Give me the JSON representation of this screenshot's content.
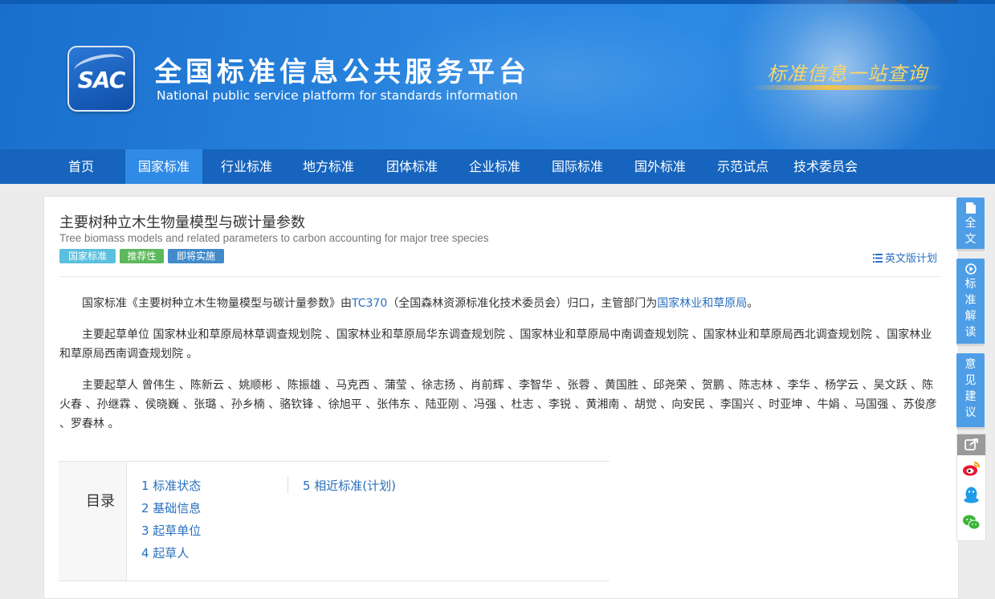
{
  "header": {
    "logo_text": "SAC",
    "title": "全国标准信息公共服务平台",
    "subtitle": "National public service platform  for standards information",
    "slogan": "标准信息一站查询"
  },
  "nav": {
    "items": [
      {
        "label": "首页",
        "active": false
      },
      {
        "label": "国家标准",
        "active": true
      },
      {
        "label": "行业标准",
        "active": false
      },
      {
        "label": "地方标准",
        "active": false
      },
      {
        "label": "团体标准",
        "active": false
      },
      {
        "label": "企业标准",
        "active": false
      },
      {
        "label": "国际标准",
        "active": false
      },
      {
        "label": "国外标准",
        "active": false
      },
      {
        "label": "示范试点",
        "active": false
      },
      {
        "label": "技术委员会",
        "active": false
      }
    ]
  },
  "standard": {
    "title": "主要树种立木生物量模型与碳计量参数",
    "title_en": "Tree biomass models and related parameters to carbon accounting for major tree species",
    "badges": [
      {
        "label": "国家标准",
        "color": "#5bc0de"
      },
      {
        "label": "推荐性",
        "color": "#5cb85c"
      },
      {
        "label": "即将实施",
        "color": "#428bca"
      }
    ],
    "english_plan_label": "英文版计划",
    "intro": {
      "prefix": "国家标准《主要树种立木生物量模型与碳计量参数》由",
      "tc_link": "TC370",
      "middle": "（全国森林资源标准化技术委员会）归口，主管部门为",
      "dept_link": "国家林业和草原局",
      "suffix": "。"
    },
    "drafting_units": "主要起草单位 国家林业和草原局林草调查规划院 、国家林业和草原局华东调查规划院 、国家林业和草原局中南调查规划院 、国家林业和草原局西北调查规划院 、国家林业和草原局西南调查规划院 。",
    "drafters": "主要起草人 曾伟生 、陈新云 、姚顺彬 、陈振雄 、马克西 、蒲莹 、徐志扬 、肖前辉 、李智华 、张蓉 、黄国胜 、邱尧荣 、贺鹏 、陈志林 、李华 、杨学云 、吴文跃 、陈火春 、孙继霖 、侯晓巍 、张璐 、孙乡楠 、骆钦锋 、徐旭平 、张伟东 、陆亚刚 、冯强 、杜志 、李锐 、黄湘南 、胡觉 、向安民 、李国兴 、时亚坤 、牛娟 、马国强 、苏俊彦 、罗春林 。"
  },
  "toc": {
    "label": "目录",
    "items": [
      "1  标准状态",
      "2  基础信息",
      "3  起草单位",
      "4  起草人",
      "5  相近标准(计划)"
    ]
  },
  "side": {
    "fulltext": "全文",
    "interpret": "标准解读",
    "feedback": "意见建议",
    "share_icons": [
      "share-icon",
      "weibo-icon",
      "qq-icon",
      "wechat-icon"
    ]
  }
}
